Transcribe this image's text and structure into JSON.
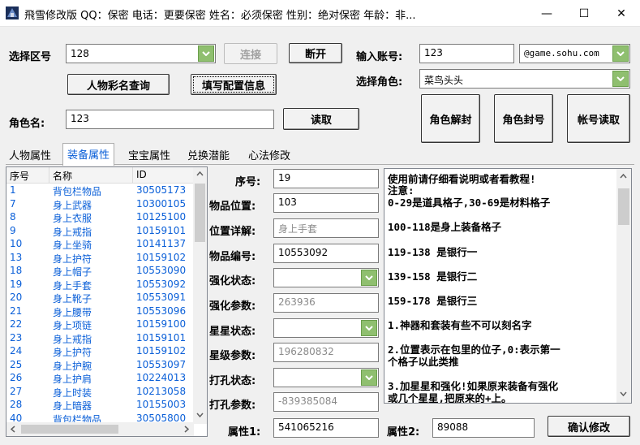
{
  "title": "飛雪修改版 QQ：保密  电话：更要保密  姓名：必须保密  性别：绝对保密  年龄：非...",
  "window_controls": {
    "minimize": "—",
    "maximize": "☐",
    "close": "✕"
  },
  "top": {
    "zone_label": "选择区号",
    "zone_value": "128",
    "connect_label": "连接",
    "disconnect_label": "断开",
    "account_label": "输入账号:",
    "account_value": "123",
    "domain_value": "@game.sohu.com",
    "role_select_label": "选择角色:",
    "role_select_value": "菜鸟头头",
    "query_button": "人物彩名查询",
    "config_button": "填写配置信息",
    "role_name_label": "角色名:",
    "role_name_value": "123",
    "read_button": "读取",
    "unseal_button": "角色解封",
    "seal_button": "角色封号",
    "account_read_button": "帐号读取"
  },
  "tabs": [
    {
      "label": "人物属性"
    },
    {
      "label": "装备属性"
    },
    {
      "label": "宝宝属性"
    },
    {
      "label": "兑换潜能"
    },
    {
      "label": "心法修改"
    }
  ],
  "list": {
    "headers": [
      "序号",
      "名称",
      "ID"
    ],
    "rows": [
      {
        "seq": "1",
        "name": "背包栏物品",
        "id": "30505173"
      },
      {
        "seq": "7",
        "name": "身上武器",
        "id": "10300105"
      },
      {
        "seq": "8",
        "name": "身上衣服",
        "id": "10125100"
      },
      {
        "seq": "9",
        "name": "身上戒指",
        "id": "10159101"
      },
      {
        "seq": "10",
        "name": "身上坐骑",
        "id": "10141137"
      },
      {
        "seq": "13",
        "name": "身上护符",
        "id": "10159102"
      },
      {
        "seq": "18",
        "name": "身上帽子",
        "id": "10553090"
      },
      {
        "seq": "19",
        "name": "身上手套",
        "id": "10553092"
      },
      {
        "seq": "20",
        "name": "身上靴子",
        "id": "10553091"
      },
      {
        "seq": "21",
        "name": "身上腰带",
        "id": "10553096"
      },
      {
        "seq": "22",
        "name": "身上项链",
        "id": "10159100"
      },
      {
        "seq": "23",
        "name": "身上戒指",
        "id": "10159101"
      },
      {
        "seq": "24",
        "name": "身上护符",
        "id": "10159102"
      },
      {
        "seq": "25",
        "name": "身上护腕",
        "id": "10553097"
      },
      {
        "seq": "26",
        "name": "身上护肩",
        "id": "10224013"
      },
      {
        "seq": "27",
        "name": "身上时装",
        "id": "10213058"
      },
      {
        "seq": "28",
        "name": "身上暗器",
        "id": "10155003"
      },
      {
        "seq": "40",
        "name": "背包栏物品",
        "id": "30505800"
      }
    ]
  },
  "form": {
    "seq_label": "序号:",
    "seq_value": "19",
    "pos_label": "物品位置:",
    "pos_value": "103",
    "pos_detail_label": "位置详解:",
    "pos_detail_value": "身上手套",
    "item_no_label": "物品编号:",
    "item_no_value": "10553092",
    "enhance_state_label": "强化状态:",
    "enhance_param_label": "强化参数:",
    "enhance_param_value": "263936",
    "star_state_label": "星星状态:",
    "star_param_label": "星级参数:",
    "star_param_value": "196280832",
    "hole_state_label": "打孔状态:",
    "hole_param_label": "打孔参数:",
    "hole_param_value": "-839385084",
    "attr1_label": "属性1:",
    "attr1_value": "541065216",
    "attr2_label": "属性2:",
    "attr2_value": "89088",
    "confirm_button": "确认修改"
  },
  "notes": [
    "使用前请仔细看说明或者看教程!",
    "注意:",
    "0-29是道具格子,30-69是材料格子",
    "100-118是身上装备格子",
    "119-138 是银行一",
    "139-158 是银行二",
    "159-178 是银行三",
    "1.神器和套装有些不可以刻名字",
    "2.位置表示在包里的位子,0:表示第一",
    "个格子以此类推",
    "3.加星星和强化!如果原来装备有强化",
    "或几个星星,把原来的+上。"
  ],
  "colors": {
    "accent": "#0a5fd8",
    "combo_arrow": "#8fbf6f"
  }
}
